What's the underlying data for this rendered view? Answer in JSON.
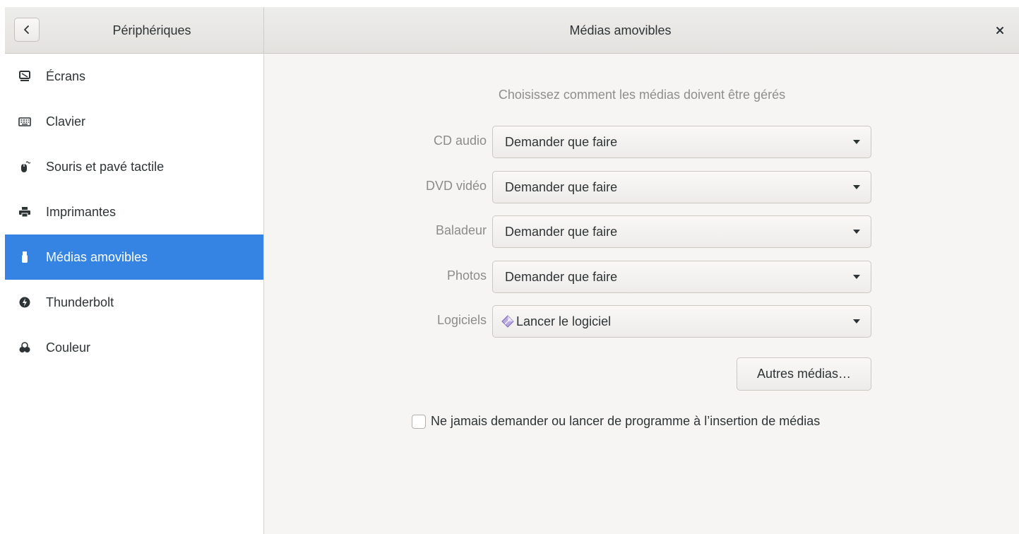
{
  "header": {
    "back_icon": "go-previous-icon",
    "left_title": "Périphériques",
    "main_title": "Médias amovibles",
    "close_icon": "window-close-icon"
  },
  "sidebar": {
    "items": [
      {
        "label": "Écrans",
        "icon": "display-icon",
        "active": false
      },
      {
        "label": "Clavier",
        "icon": "keyboard-icon",
        "active": false
      },
      {
        "label": "Souris et pavé tactile",
        "icon": "mouse-icon",
        "active": false
      },
      {
        "label": "Imprimantes",
        "icon": "printer-icon",
        "active": false
      },
      {
        "label": "Médias amovibles",
        "icon": "usb-drive-icon",
        "active": true
      },
      {
        "label": "Thunderbolt",
        "icon": "thunderbolt-icon",
        "active": false
      },
      {
        "label": "Couleur",
        "icon": "color-icon",
        "active": false
      }
    ]
  },
  "main": {
    "heading": "Choisissez comment les médias doivent être gérés",
    "rows": [
      {
        "label": "CD audio",
        "value": "Demander que faire"
      },
      {
        "label": "DVD vidéo",
        "value": "Demander que faire"
      },
      {
        "label": "Baladeur",
        "value": "Demander que faire"
      },
      {
        "label": "Photos",
        "value": "Demander que faire"
      },
      {
        "label": "Logiciels",
        "value": "Lancer le logiciel",
        "icon": "software-launcher-icon"
      }
    ],
    "other_media_button": "Autres médias…",
    "never_prompt_checkbox": {
      "label": "Ne jamais demander ou lancer de programme à l’insertion de médias",
      "checked": false
    }
  },
  "colors": {
    "accent": "#3584e4",
    "dim_text": "#8e8e8c",
    "window_bg": "#f6f5f4"
  }
}
